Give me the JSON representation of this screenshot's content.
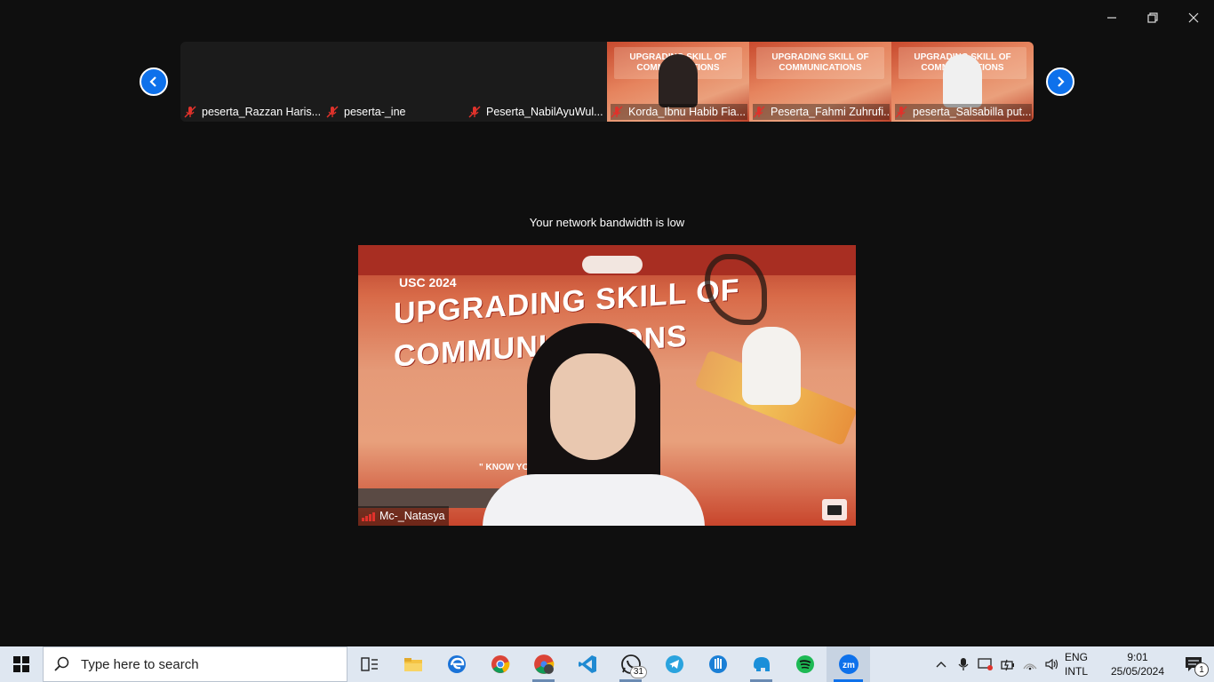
{
  "window": {
    "controls": [
      "minimize",
      "restore",
      "close"
    ]
  },
  "strip": {
    "participants": [
      {
        "name": "peserta_Razzan Haris...",
        "video": false,
        "muted": true
      },
      {
        "name": "peserta-_ine",
        "video": false,
        "muted": true
      },
      {
        "name": "Peserta_NabilAyuWul...",
        "video": false,
        "muted": true
      },
      {
        "name": "Korda_Ibnu Habib Fia...",
        "video": true,
        "muted": true
      },
      {
        "name": "Peserta_Fahmi Zuhrufi...",
        "video": true,
        "muted": true
      },
      {
        "name": "peserta_Salsabilla put...",
        "video": true,
        "muted": true
      }
    ]
  },
  "notice": "Your network bandwidth is low",
  "main_video": {
    "speaker_name": "Mc-_Natasya",
    "slide_year": "USC 2024",
    "slide_title_line1": "UPGRADING SKILL OF",
    "slide_title_line2": "COMMUNICATIONS",
    "slide_tagline": "\" KNOW YOUR ... LE AND LET'S SPEAK \""
  },
  "strip_tile_banner": "UPGRADING SKILL OF COMMUNICATIONS",
  "taskbar": {
    "search_placeholder": "Type here to search",
    "apps": [
      {
        "name": "task-view",
        "state": ""
      },
      {
        "name": "file-explorer",
        "state": ""
      },
      {
        "name": "edge",
        "state": ""
      },
      {
        "name": "chrome",
        "state": ""
      },
      {
        "name": "chrome-profile",
        "state": "open"
      },
      {
        "name": "vscode",
        "state": ""
      },
      {
        "name": "whatsapp",
        "state": "open",
        "badge": "31"
      },
      {
        "name": "telegram",
        "state": ""
      },
      {
        "name": "hand-app",
        "state": ""
      },
      {
        "name": "elephant-app",
        "state": "open"
      },
      {
        "name": "spotify",
        "state": ""
      },
      {
        "name": "zoom",
        "state": "active"
      }
    ],
    "tray": {
      "lang_line1": "ENG",
      "lang_line2": "INTL",
      "time": "9:01",
      "date": "25/05/2024",
      "notification_count": "1"
    }
  },
  "colors": {
    "zoom_blue": "#0e71eb",
    "window_bg": "#0f0f0f",
    "taskbar_bg": "#dfe7f1",
    "muted_red": "#e0322b"
  }
}
